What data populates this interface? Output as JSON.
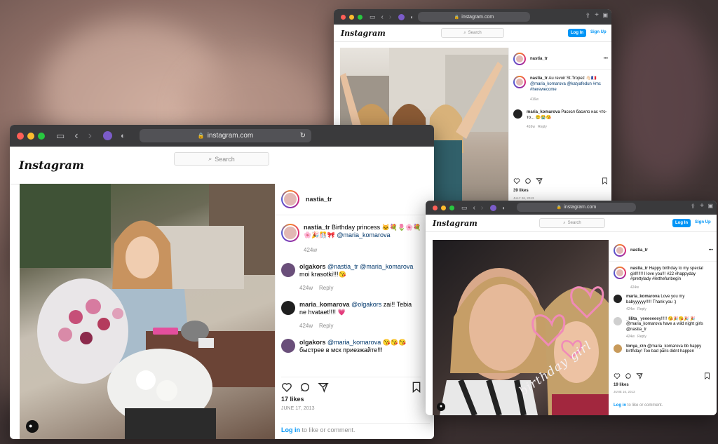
{
  "background": {
    "color": "#3b3031"
  },
  "window_left": {
    "url": "instagram.com",
    "logo": "Instagram",
    "search_placeholder": "Search",
    "post": {
      "username": "nastia_tr",
      "caption_user": "nastia_tr",
      "caption": "Birthday princess 🐱💐🌷🌸💐🌸🎉🎊🎀",
      "caption_mention": "@maria_komarova",
      "caption_age": "424w",
      "comments": [
        {
          "user": "olgakors",
          "text_mention": "@nastia_tr @maria_komarova",
          "text": "moi krasotki!!!😘",
          "age": "424w",
          "reply": "Reply"
        },
        {
          "user": "maria_komarova",
          "text_mention": "@olgakors",
          "text": "zai!! Tebia ne hvataet!!!! 💗",
          "age": "424w",
          "reply": "Reply"
        },
        {
          "user": "olgakors",
          "text_mention": "@maria_komarova",
          "text": "😘😘😘 быстрее в мск приезжайте!!!",
          "age": "",
          "reply": ""
        }
      ],
      "likes": "17 likes",
      "date": "JUNE 17, 2013",
      "login_link": "Log in",
      "login_rest": "to like or comment."
    }
  },
  "window_top": {
    "url": "instagram.com",
    "logo": "Instagram",
    "search_placeholder": "Search",
    "login_button": "Log In",
    "signup_link": "Sign Up",
    "post": {
      "username": "nastia_tr",
      "more": "•••",
      "caption_user": "nastia_tr",
      "caption": "Au revoir St.Tropez 👋🏻🇫🇷",
      "caption_mentions": "@maria_komarova @katyafedun #mc #herewecome",
      "caption_age": "416w",
      "comments": [
        {
          "user": "maria_komarova",
          "text": "Раскол басило нас что-то... 😢😭😘",
          "age": "416w",
          "reply": "Reply"
        }
      ],
      "likes": "39 likes",
      "date": "JULY 26, 2013"
    }
  },
  "window_right": {
    "url": "instagram.com",
    "logo": "Instagram",
    "search_placeholder": "Search",
    "login_button": "Log In",
    "signup_link": "Sign Up",
    "photo_overlay_text": "birthday girl",
    "post": {
      "username": "nastia_tr",
      "more": "•••",
      "caption_user": "nastia_tr",
      "caption": "Happy birthday to my special girl!!!!!! I love you!!! #22 #happyday #prettylady #letthefunbegin",
      "caption_age": "424w",
      "comments": [
        {
          "user": "maria_komarova",
          "text": "Love you my babyyyyyy!!!!! Thank you :)",
          "age": "424w",
          "reply": "Reply"
        },
        {
          "user": "_lilita_",
          "text": "yeeeeeeey!!!!! 😘🎉😘🎉 🎉 @maria_komarova have a wild night girls @nastia_tr",
          "age": "424w",
          "reply": "Reply"
        },
        {
          "user": "tonya_rzn",
          "text": "@maria_komarova bb happy birthday! Too bad paris didnt happen",
          "age": "",
          "reply": ""
        }
      ],
      "likes": "19 likes",
      "date": "JUNE 16, 2013",
      "login_link": "Log in",
      "login_rest": "to like or comment."
    }
  }
}
